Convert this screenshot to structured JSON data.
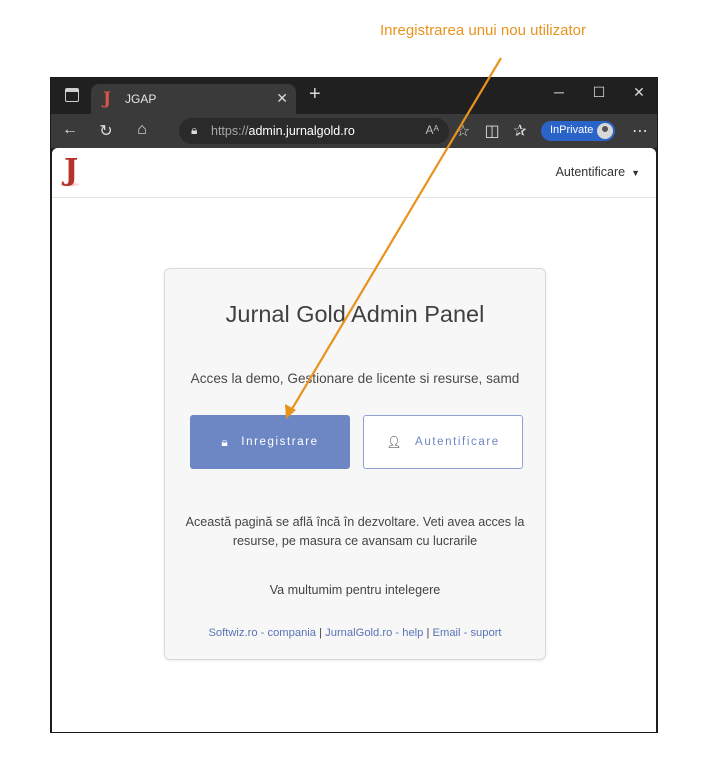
{
  "annotation": {
    "text": "Inregistrarea unui nou utilizator",
    "color": "#E8931E"
  },
  "browser": {
    "tab": {
      "title": "JGAP",
      "favicon": "J"
    },
    "url": {
      "scheme": "https://",
      "host": "admin.jurnalgold.ro"
    },
    "read_aloud": "Aᴬ",
    "inprivate_label": "InPrivate"
  },
  "site": {
    "logo": "J",
    "nav_auth_label": "Autentificare",
    "card": {
      "title": "Jurnal Gold Admin Panel",
      "description": "Acces la demo, Gestionare de licente si resurse, samd",
      "register_label": "Inregistrare",
      "login_label": "Autentificare",
      "note": "Această pagină se află încă în dezvoltare. Veti avea acces la resurse, pe masura ce avansam cu lucrarile",
      "thanks": "Va multumim pentru intelegere",
      "links": [
        {
          "label": "Softwiz.ro - compania"
        },
        {
          "label": "JurnalGold.ro - help"
        },
        {
          "label": "Email - suport"
        }
      ],
      "link_separator": "|"
    }
  },
  "colors": {
    "accent": "#6D86C4",
    "logo_red": "#B7322B",
    "inprivate_blue": "#2B64C9"
  }
}
